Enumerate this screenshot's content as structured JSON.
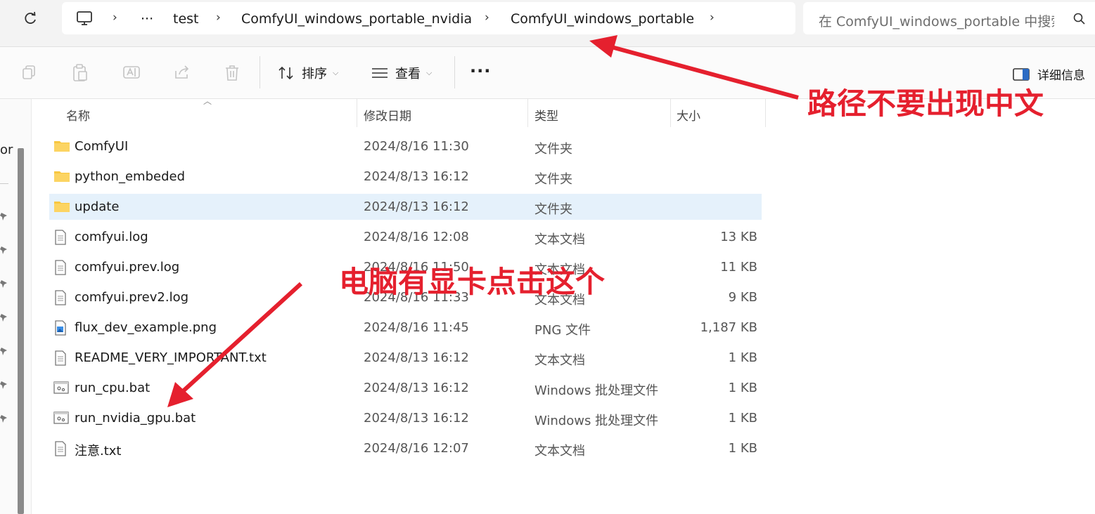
{
  "address_bar": {
    "refresh_icon": "refresh-icon",
    "computer_icon": "monitor-icon",
    "overflow": "···",
    "breadcrumbs": [
      "test",
      "ComfyUI_windows_portable_nvidia",
      "ComfyUI_windows_portable"
    ],
    "search_placeholder": "在 ComfyUI_windows_portable 中搜索"
  },
  "toolbar": {
    "sort_label": "排序",
    "view_label": "查看",
    "more_label": "···",
    "details_label": "详细信息",
    "icons": [
      "copy-icon",
      "paste-icon",
      "rename-icon",
      "share-icon",
      "delete-icon"
    ]
  },
  "nav": {
    "fragment_text": "or"
  },
  "columns": {
    "name": "名称",
    "modified": "修改日期",
    "type": "类型",
    "size": "大小"
  },
  "files": [
    {
      "name": "ComfyUI",
      "modified": "2024/8/16 11:30",
      "type": "文件夹",
      "size": "",
      "icon": "folder-icon",
      "selected": false
    },
    {
      "name": "python_embeded",
      "modified": "2024/8/13 16:12",
      "type": "文件夹",
      "size": "",
      "icon": "folder-icon",
      "selected": false
    },
    {
      "name": "update",
      "modified": "2024/8/13 16:12",
      "type": "文件夹",
      "size": "",
      "icon": "folder-icon",
      "selected": true
    },
    {
      "name": "comfyui.log",
      "modified": "2024/8/16 12:08",
      "type": "文本文档",
      "size": "13 KB",
      "icon": "text-file-icon",
      "selected": false
    },
    {
      "name": "comfyui.prev.log",
      "modified": "2024/8/16 11:50",
      "type": "文本文档",
      "size": "11 KB",
      "icon": "text-file-icon",
      "selected": false
    },
    {
      "name": "comfyui.prev2.log",
      "modified": "2024/8/16 11:33",
      "type": "文本文档",
      "size": "9 KB",
      "icon": "text-file-icon",
      "selected": false
    },
    {
      "name": "flux_dev_example.png",
      "modified": "2024/8/16 11:45",
      "type": "PNG 文件",
      "size": "1,187 KB",
      "icon": "image-file-icon",
      "selected": false
    },
    {
      "name": "README_VERY_IMPORTANT.txt",
      "modified": "2024/8/13 16:12",
      "type": "文本文档",
      "size": "1 KB",
      "icon": "text-file-icon",
      "selected": false
    },
    {
      "name": "run_cpu.bat",
      "modified": "2024/8/13 16:12",
      "type": "Windows 批处理文件",
      "size": "1 KB",
      "icon": "batch-file-icon",
      "selected": false
    },
    {
      "name": "run_nvidia_gpu.bat",
      "modified": "2024/8/13 16:12",
      "type": "Windows 批处理文件",
      "size": "1 KB",
      "icon": "batch-file-icon",
      "selected": false
    },
    {
      "name": "注意.txt",
      "modified": "2024/8/16 12:07",
      "type": "文本文档",
      "size": "1 KB",
      "icon": "text-file-icon",
      "selected": false
    }
  ],
  "annotations": {
    "path_note": "路径不要出现中文",
    "gpu_note": "电脑有显卡点击这个",
    "color": "#e5202e"
  },
  "colors": {
    "selection": "#e5f1fb",
    "folder": "#f8c740",
    "accent": "#e5202e"
  }
}
